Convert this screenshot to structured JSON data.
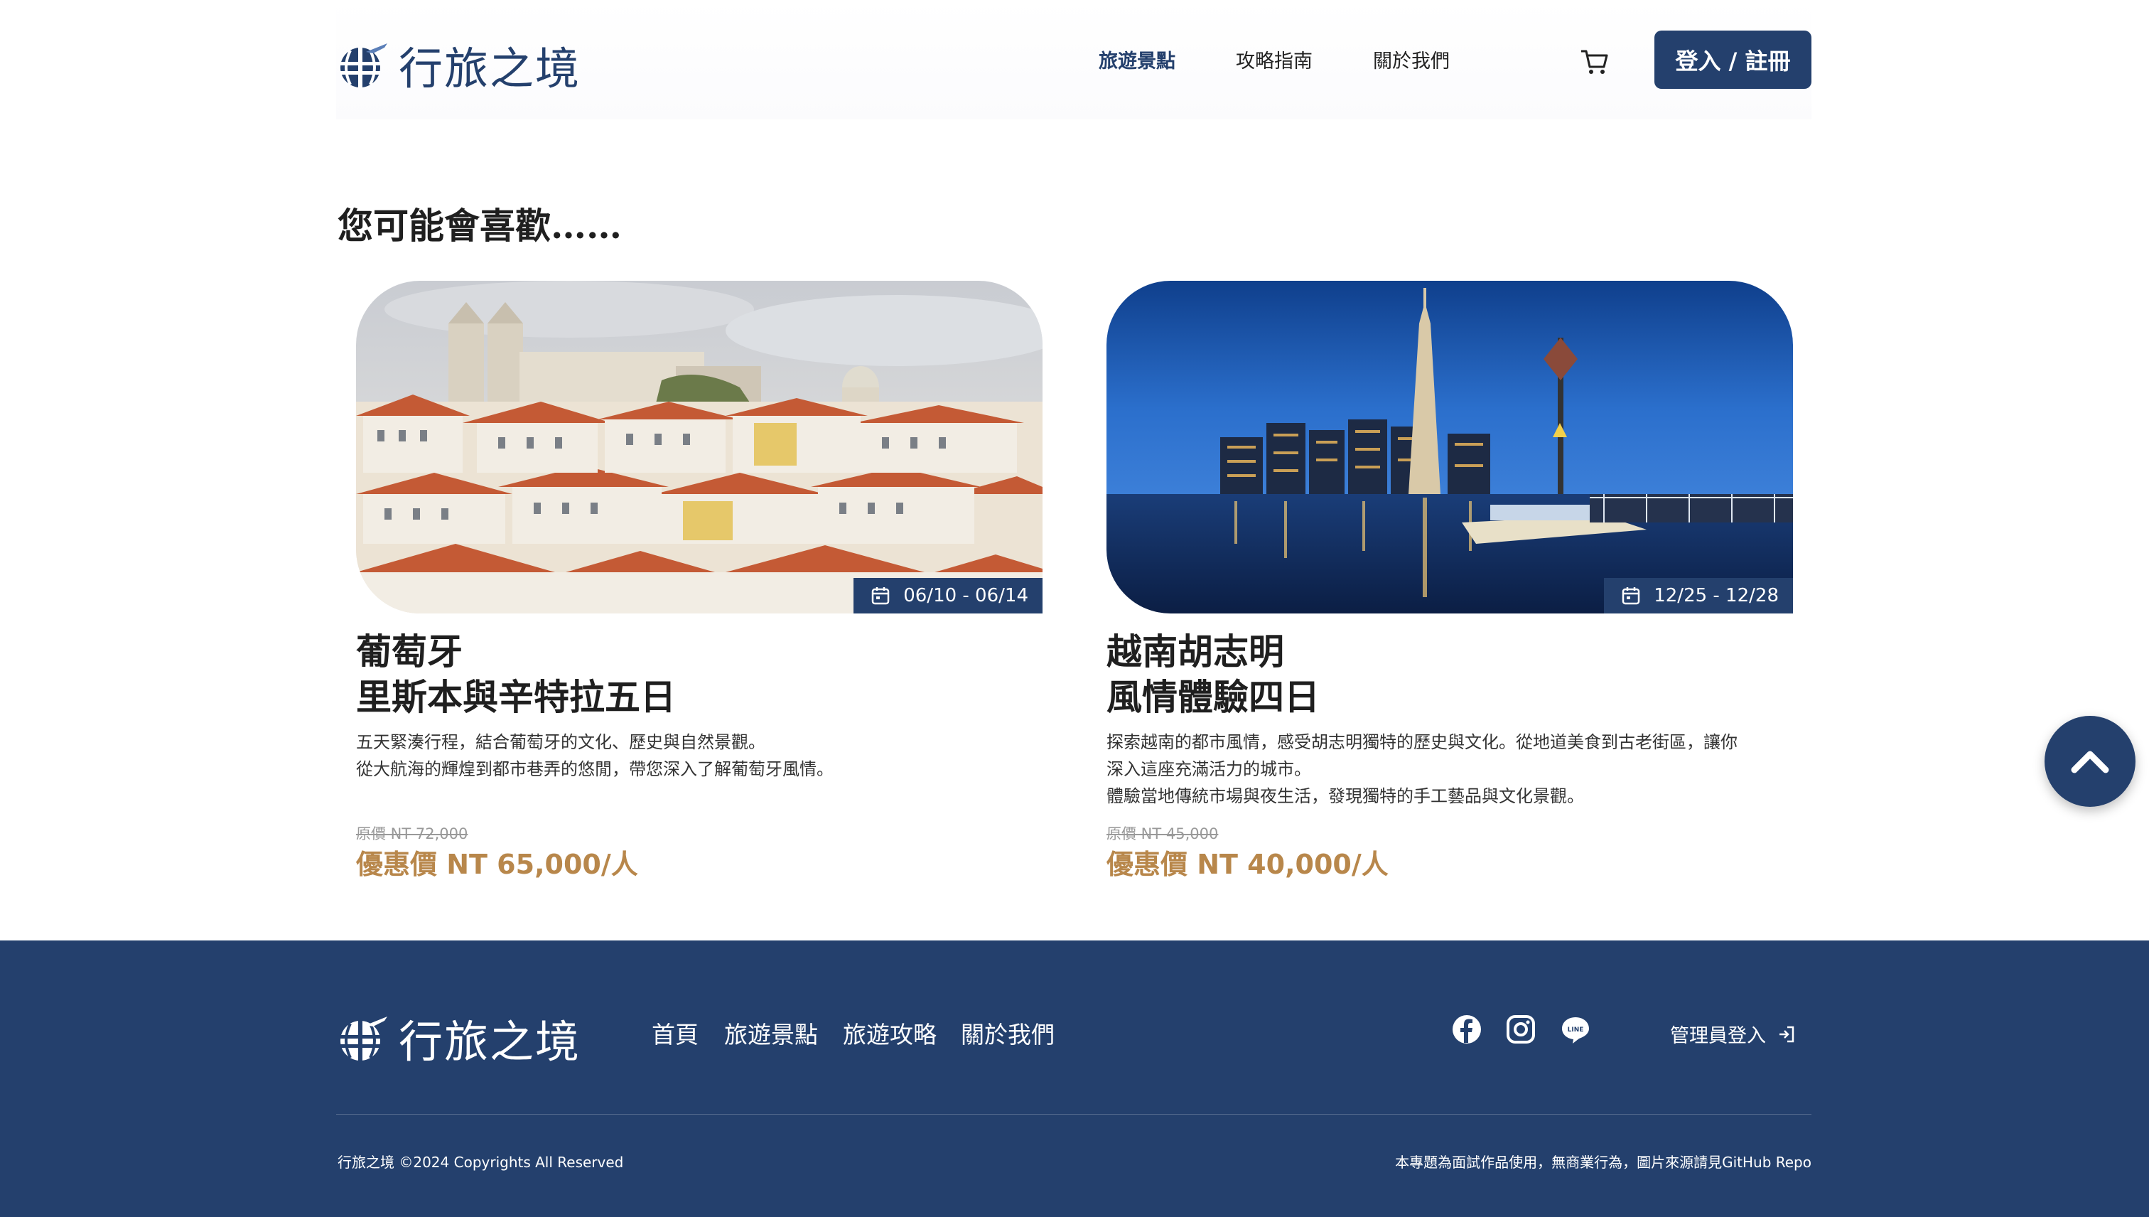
{
  "brand": {
    "name": "行旅之境",
    "logo_icon": "globe-plane-icon",
    "color": "#24406d"
  },
  "header": {
    "nav": [
      {
        "label": "旅遊景點",
        "active": true
      },
      {
        "label": "攻略指南",
        "active": false
      },
      {
        "label": "關於我們",
        "active": false
      }
    ],
    "cart_icon": "cart-icon",
    "login_label": "登入 / 註冊"
  },
  "section": {
    "title": "您可能會喜歡……"
  },
  "cards": [
    {
      "date": "06/10 - 06/14",
      "title_lines": [
        "葡萄牙",
        "里斯本與辛特拉五日"
      ],
      "desc_lines": [
        "五天緊湊行程，結合葡萄牙的文化、歷史與自然景觀。",
        "從大航海的輝煌到都市巷弄的悠閒，帶您深入了解葡萄牙風情。"
      ],
      "original_price": "原價 NT 72,000",
      "sale_price": "優惠價 NT 65,000/人",
      "image": "lisbon-cityscape"
    },
    {
      "date": "12/25 - 12/28",
      "title_lines": [
        "越南胡志明",
        "風情體驗四日"
      ],
      "desc_lines": [
        "探索越南的都市風情，感受胡志明獨特的歷史與文化。從地道美食到古老街區，讓你",
        "深入這座充滿活力的城市。",
        "體驗當地傳統市場與夜生活，發現獨特的手工藝品與文化景觀。"
      ],
      "original_price": "原價 NT 45,000",
      "sale_price": "優惠價 NT 40,000/人",
      "image": "saigon-night-river"
    }
  ],
  "back_to_top_icon": "chevron-up-icon",
  "footer": {
    "links": [
      "首頁",
      "旅遊景點",
      "旅遊攻略",
      "關於我們"
    ],
    "social_icons": [
      "facebook-icon",
      "instagram-icon",
      "line-icon"
    ],
    "admin_label": "管理員登入",
    "copyright": "行旅之境 ©2024 Copyrights All Reserved",
    "disclaimer": "本專題為面試作品使用，無商業行為，圖片來源請見GitHub Repo"
  },
  "colors": {
    "primary": "#24406d",
    "price": "#b8874b",
    "strike": "#999999"
  }
}
